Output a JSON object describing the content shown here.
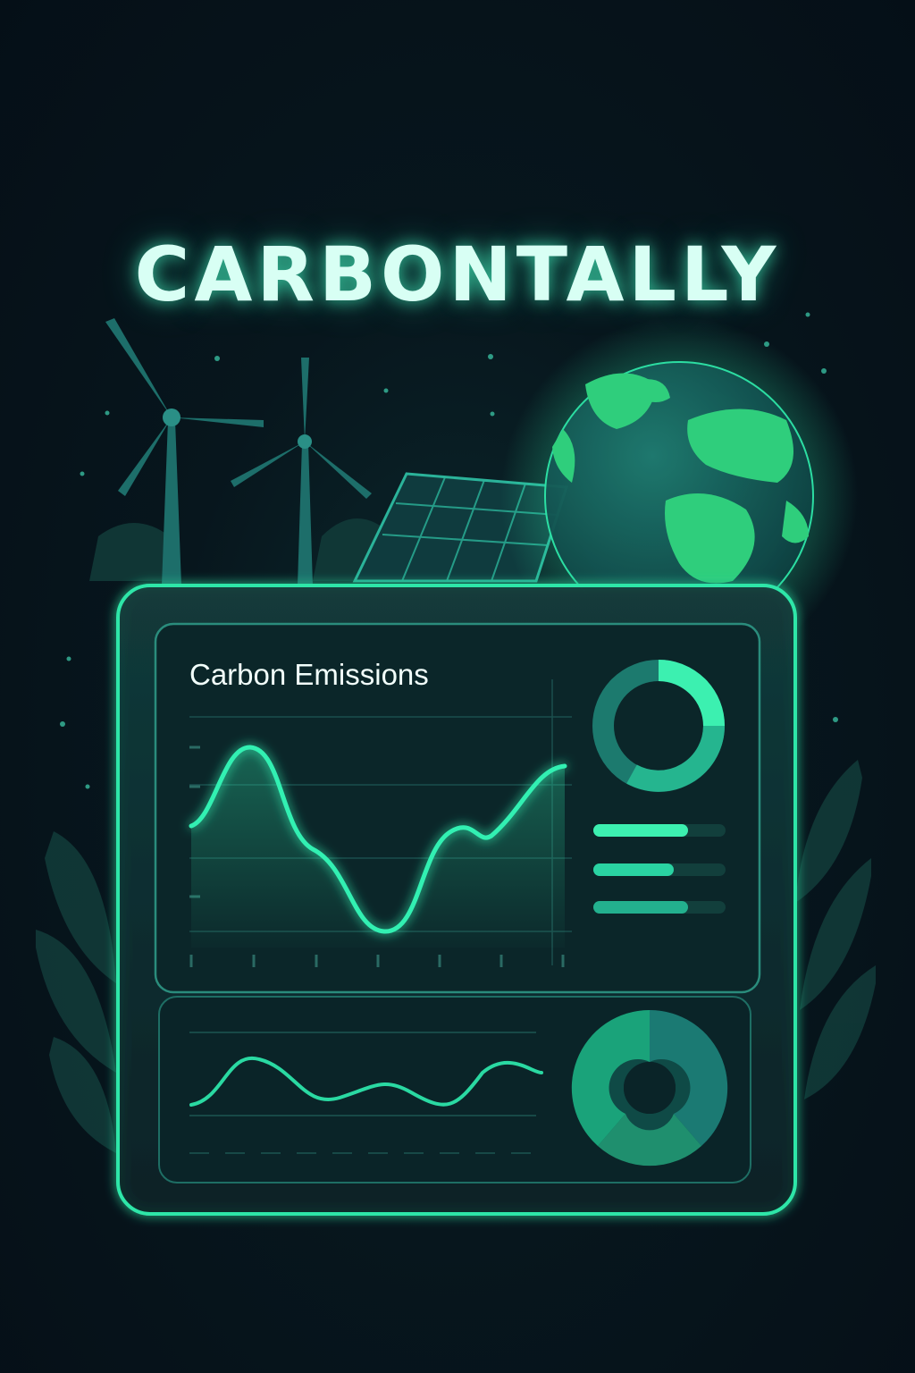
{
  "brand": {
    "name": "CARBONTALLY"
  },
  "dashboard": {
    "title": "Carbon Emissions"
  },
  "colors": {
    "accent": "#38f0b0",
    "accent_dim": "#1e9a86",
    "background": "#06121a",
    "glow": "#46f0be"
  },
  "icons": [
    "wind-turbine-icon",
    "solar-panel-icon",
    "globe-icon",
    "leaf-icon"
  ]
}
